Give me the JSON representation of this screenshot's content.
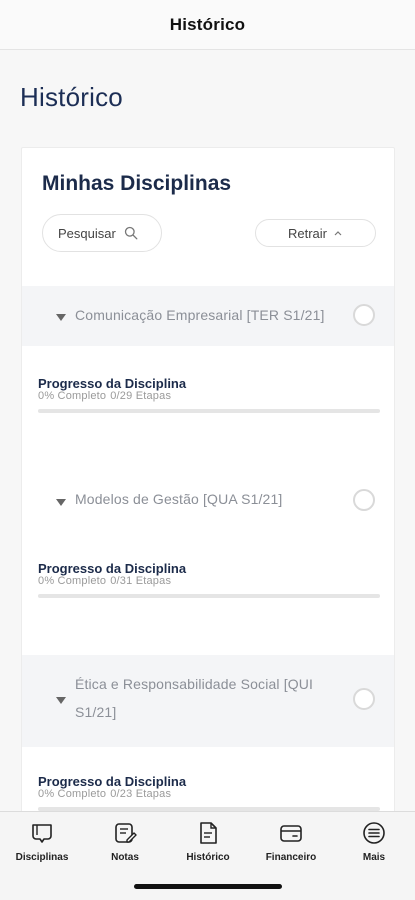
{
  "navbar": {
    "title": "Histórico"
  },
  "page": {
    "heading": "Histórico"
  },
  "card": {
    "title": "Minhas Disciplinas",
    "search_label": "Pesquisar",
    "collapse_label": "Retrair"
  },
  "courses": [
    {
      "name_lines": [
        "Comunicação Empresarial [TER S1/21]"
      ],
      "progress_label": "Progresso da Disciplina",
      "percent_text": "0% Completo",
      "steps_text": "0/29 Etapas",
      "progress": 0
    },
    {
      "name_lines": [
        "Modelos de Gestão [QUA S1/21]"
      ],
      "progress_label": "Progresso da Disciplina",
      "percent_text": "0% Completo",
      "steps_text": "0/31 Etapas",
      "progress": 0
    },
    {
      "name_lines": [
        "Ética e Responsabilidade Social [QUI",
        "S1/21]"
      ],
      "progress_label": "Progresso da Disciplina",
      "percent_text": "0% Completo",
      "steps_text": "0/23 Etapas",
      "progress": 0
    }
  ],
  "tabbar": {
    "items": [
      {
        "label": "Disciplinas",
        "icon": "book-icon"
      },
      {
        "label": "Notas",
        "icon": "grades-icon"
      },
      {
        "label": "Histórico",
        "icon": "document-icon"
      },
      {
        "label": "Financeiro",
        "icon": "wallet-icon"
      },
      {
        "label": "Mais",
        "icon": "menu-icon"
      }
    ]
  },
  "colors": {
    "heading": "#1c2e55",
    "course_name": "#8b8f97",
    "track": "#e5e5e5",
    "header_shade": "#f4f5f7"
  }
}
